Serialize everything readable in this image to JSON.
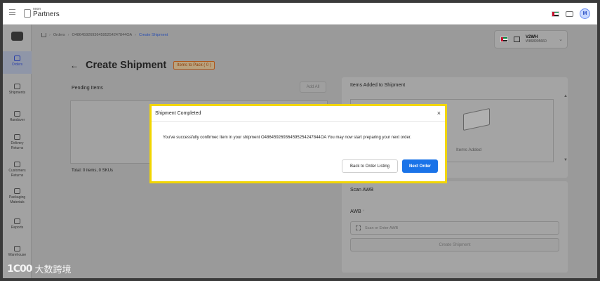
{
  "header": {
    "logo_small": "noon",
    "logo_big": "Partners",
    "avatar_initial": "M"
  },
  "sidebar": {
    "items": [
      {
        "label": "Orders",
        "icon": "orders-icon",
        "active": true
      },
      {
        "label": "Shipments",
        "icon": "truck-icon"
      },
      {
        "label": "Handover",
        "icon": "handover-icon"
      },
      {
        "label": "Delivery Returns",
        "icon": "delivery-returns-icon"
      },
      {
        "label": "Customers Returns",
        "icon": "customer-returns-icon"
      },
      {
        "label": "Packaging Materials",
        "icon": "packaging-icon"
      },
      {
        "label": "Reports",
        "icon": "reports-icon"
      },
      {
        "label": "Warehouse",
        "icon": "warehouse-icon"
      }
    ]
  },
  "breadcrumb": {
    "items": [
      "Orders",
      "O48645926936459525424784 40A",
      "Create Shipment"
    ],
    "orders": "Orders",
    "order_id": "O486459269364595254247844OA",
    "current": "Create Shipment"
  },
  "store": {
    "name": "V2WH",
    "id": "W868995660"
  },
  "page": {
    "title": "Create Shipment",
    "badge": "Items to Pack ( 0 )"
  },
  "pending": {
    "title": "Pending Items",
    "add_all": "Add All",
    "total": "Total: 0 items, 0 SKUs"
  },
  "added": {
    "title": "Items Added to Shipment",
    "empty_text": "Items Added"
  },
  "scan": {
    "title": "Scan AWB",
    "awb_label": "AWB",
    "awb_required": "*",
    "awb_placeholder": "Scan or Enter AWB",
    "create_button": "Create Shipment"
  },
  "modal": {
    "title": "Shipment Completed",
    "close": "×",
    "message": "You've successfully confirmec  Item in your shipment O486459269364595254247844OA You may now start preparing your next order.",
    "back_button": "Back to Order Listing",
    "next_button": "Next Order"
  },
  "watermark": {
    "logo": "1C00",
    "text": "大数跨境"
  },
  "colors": {
    "primary": "#1a73e8",
    "highlight_border": "#f2d600",
    "badge_text": "#8a3a06"
  }
}
